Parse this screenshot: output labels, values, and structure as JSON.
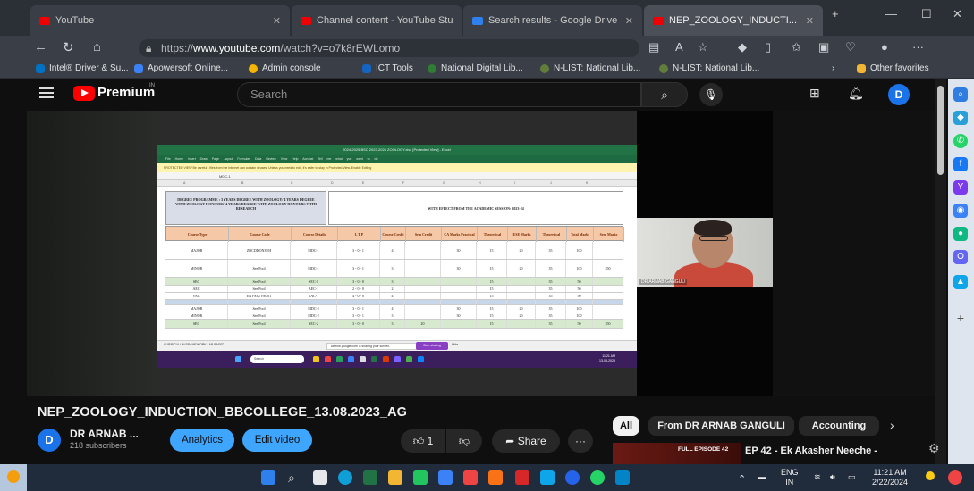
{
  "browser": {
    "tabs": [
      {
        "label": "YouTube"
      },
      {
        "label": "Channel content - YouTube Stu"
      },
      {
        "label": "Search results - Google Drive"
      },
      {
        "label": "NEP_ZOOLOGY_INDUCTI..."
      }
    ],
    "url_prefix": "https://",
    "url_host": "www.youtube.com",
    "url_path": "/watch?v=o7k8rEWLomo",
    "bookmarks": [
      {
        "label": "Intel® Driver & Su..."
      },
      {
        "label": "Apowersoft Online..."
      },
      {
        "label": "Admin console"
      },
      {
        "label": "ICT Tools"
      },
      {
        "label": "National Digital Lib..."
      },
      {
        "label": "N-LIST: National Lib..."
      },
      {
        "label": "N-LIST: National Lib..."
      }
    ],
    "other_favorites": "Other favorites"
  },
  "youtube": {
    "brand": "Premium",
    "region": "IN",
    "search_placeholder": "Search",
    "avatar_letter": "D"
  },
  "excel": {
    "title_bar": "2024-2025 BSC 2023-2024 ZOOLOGY.xlsx [Protected View] - Excel",
    "ribbon": "File Home Insert Draw Page Layout Formulas Data Review View Help Acrobat Tell me what you want to do",
    "protected_note": "PROTECTED VIEW  Be careful - files from the Internet can contain viruses. Unless you need to edit, it's safer to stay in Protected View.   Enable Editing",
    "formula": "MDC-1",
    "columns": [
      "A",
      "B",
      "C",
      "D",
      "E",
      "F",
      "G",
      "H",
      "I",
      "J",
      "K"
    ],
    "heading": "DEGREE PROGRAMME : 3 YEARS DEGREE WITH ZOOLOGY/ 4 YEARS DEGREE WITH ZOOLOGY HONOURS/ 4 YEARS DEGREE WITH ZOOLOGY HONOURS WITH RESEARCH",
    "effect": "WITH EFFECT FROM THE ACADEMIC SESSION: 2023-24",
    "headers": [
      "Course Type",
      "Course Code",
      "Course Details",
      "L  T  P",
      "Course Credit",
      "Sem Credit",
      "CA Marks Practical",
      "Theoretical",
      "ESE Marks Practical",
      "Theoretical",
      "Total Marks",
      "Sem Marks"
    ],
    "rows": [
      {
        "type": "MAJOR",
        "code": "ZOCDDON3UH",
        "details": "MDC-1",
        "ltp": "3 - 0 - 1",
        "credit": "4",
        "sem": "",
        "ca_p": "30",
        "ca_t": "15",
        "ese_p": "20",
        "ese_t": "35",
        "total": "100",
        "sem_marks": "",
        "style": "white"
      },
      {
        "type": "MINOR",
        "code": "See Pool",
        "details": "MDC-1",
        "ltp": "3 - 0 - 1",
        "credit": "3",
        "sem": "",
        "ca_p": "30",
        "ca_t": "15",
        "ese_p": "20",
        "ese_t": "35",
        "total": "100",
        "sem_marks": "350",
        "style": "white"
      },
      {
        "type": "SEC",
        "code": "See Pool",
        "details": "SEC-1",
        "ltp": "3 - 0 - 0",
        "credit": "3",
        "sem": "",
        "ca_p": "",
        "ca_t": "15",
        "ese_p": "",
        "ese_t": "35",
        "total": "50",
        "sem_marks": "",
        "style": "green"
      },
      {
        "type": "AEC",
        "code": "See Pool",
        "details": "AEC-1",
        "ltp": "2 - 0 - 0",
        "credit": "2",
        "sem": "",
        "ca_p": "",
        "ca_t": "15",
        "ese_p": "",
        "ese_t": "35",
        "total": "50",
        "sem_marks": "",
        "style": "white"
      },
      {
        "type": "VAC",
        "code": "ENVS3UVAC01",
        "details": "VAC-1",
        "ltp": "4 - 0 - 0",
        "credit": "4",
        "sem": "",
        "ca_p": "",
        "ca_t": "15",
        "ese_p": "",
        "ese_t": "35",
        "total": "50",
        "sem_marks": "",
        "style": "white"
      },
      {
        "type": "",
        "code": "",
        "details": "",
        "ltp": "",
        "credit": "",
        "sem": "",
        "ca_p": "",
        "ca_t": "",
        "ese_p": "",
        "ese_t": "",
        "total": "",
        "sem_marks": "",
        "style": "blue"
      },
      {
        "type": "MAJOR",
        "code": "See Pool",
        "details": "MDC-2",
        "ltp": "3 - 0 - 1",
        "credit": "4",
        "sem": "",
        "ca_p": "30",
        "ca_t": "15",
        "ese_p": "20",
        "ese_t": "35",
        "total": "100",
        "sem_marks": "",
        "style": "white"
      },
      {
        "type": "MINOR",
        "code": "See Pool",
        "details": "MDC-2",
        "ltp": "3 - 0 - 1",
        "credit": "3",
        "sem": "",
        "ca_p": "30",
        "ca_t": "15",
        "ese_p": "20",
        "ese_t": "35",
        "total": "100",
        "sem_marks": "",
        "style": "white"
      },
      {
        "type": "SEC",
        "code": "See Pool",
        "details": "SEC-2",
        "ltp": "3 - 0 - 0",
        "credit": "3",
        "sem": "20",
        "ca_p": "",
        "ca_t": "15",
        "ese_p": "",
        "ese_t": "35",
        "total": "50",
        "sem_marks": "350",
        "style": "green"
      }
    ],
    "curriculum_note": "CURRICULUM FRAMEWORK LAB BASED",
    "share_note": "Attendi.google.com is sharing your screen.",
    "stop_sharing": "Stop sharing",
    "hide": "Hide",
    "taskbar_search": "Search",
    "taskbar_time": "11:21 AM",
    "taskbar_date": "13-08-2023"
  },
  "speaker": {
    "name_label": "DR ARNAB GANGULI"
  },
  "video": {
    "title": "NEP_ZOOLOGY_INDUCTION_BBCOLLEGE_13.08.2023_AG",
    "channel_letter": "D",
    "channel_name": "DR ARNAB ...",
    "subscribers": "218 subscribers",
    "analytics_label": "Analytics",
    "edit_label": "Edit video",
    "like_count": "1",
    "share_label": "Share",
    "more_label": "···"
  },
  "recommendations": {
    "chips": [
      {
        "label": "All",
        "active": true
      },
      {
        "label": "From DR ARNAB GANGULI",
        "active": false
      },
      {
        "label": "Accounting",
        "active": false
      }
    ],
    "first_badge": "FULL EPISODE 42",
    "first_title": "EP 42 - Ek Akasher Neeche -"
  },
  "taskbar": {
    "lang_line1": "ENG",
    "lang_line2": "IN",
    "time": "11:21 AM",
    "date": "2/22/2024"
  },
  "colors": {
    "youtube_red": "#ff0000",
    "accent_blue": "#3ea6ff",
    "excel_green": "#217346"
  }
}
